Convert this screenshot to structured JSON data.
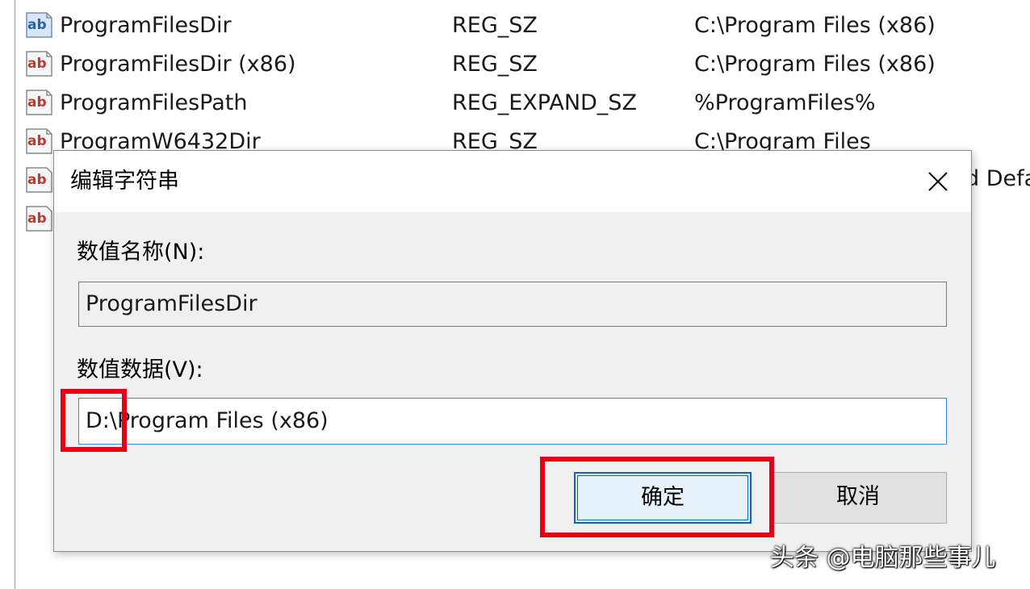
{
  "registry": {
    "rows": [
      {
        "name": "ProgramFilesDir",
        "type": "REG_SZ",
        "data": "C:\\Program Files (x86)"
      },
      {
        "name": "ProgramFilesDir (x86)",
        "type": "REG_SZ",
        "data": "C:\\Program Files (x86)"
      },
      {
        "name": "ProgramFilesPath",
        "type": "REG_EXPAND_SZ",
        "data": "%ProgramFiles%"
      },
      {
        "name": "ProgramW6432Dir",
        "type": "REG_SZ",
        "data": "C:\\Program Files"
      }
    ],
    "clipped_text": "d Defa",
    "icon_label": "ab"
  },
  "dialog": {
    "title": "编辑字符串",
    "name_label": "数值名称(N):",
    "name_value": "ProgramFilesDir",
    "data_label": "数值数据(V):",
    "data_value": "D:\\Program Files (x86)",
    "ok_label": "确定",
    "cancel_label": "取消"
  },
  "watermark": "头条 @电脑那些事儿",
  "colors": {
    "dialog_bg": "#f0f0f0",
    "accent": "#0a64c8",
    "annotation": "#e60012"
  }
}
